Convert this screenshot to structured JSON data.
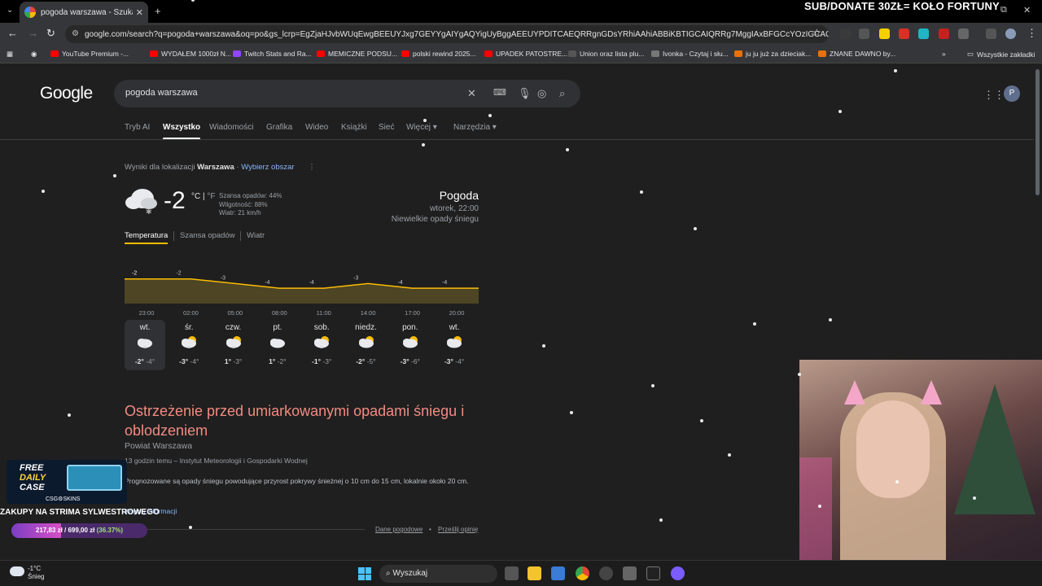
{
  "browser": {
    "tab_title": "pogoda warszawa - Szukaj w Go",
    "new_tab": "+",
    "url": "google.com/search?q=pogoda+warszawa&oq=po&gs_lcrp=EgZjaHJvbWUqEwgBEEUYJxg7GEYYgAIYgAQYigUyBggAEEUYPDITCAEQRRgnGDsYRhiAAhiABBiKBTIGCAIQRRg7MggIAxBFGCcYOzIGCAQQRRg8MgYIBRBF",
    "overlay_text": "SUB/DONATE 30ZŁ= KOŁO FORTUNY",
    "bookmarks": [
      "YouTube Premium -...",
      "WYDAŁEM 1000zł N...",
      "Twitch Stats and Ra...",
      "MEMICZNE PODSU...",
      "polski rewind 2025...",
      "UPADEK PATOSTRE...",
      "Union oraz lista plu...",
      "Ivonka - Czytaj i słu...",
      "ju ju już za dzieciak...",
      "ZNANE DAWNO by..."
    ],
    "all_bookmarks": "Wszystkie zakładki"
  },
  "google": {
    "logo": "Google",
    "query": "pogoda warszawa",
    "avatar": "P",
    "tabs": [
      "Tryb AI",
      "Wszystko",
      "Wiadomości",
      "Grafika",
      "Wideo",
      "Książki",
      "Sieć",
      "Więcej ▾",
      "Narzędzia ▾"
    ],
    "location_prefix": "Wyniki dla lokalizacji",
    "location": "Warszawa",
    "location_sep": " · ",
    "location_link": "Wybierz obszar"
  },
  "weather": {
    "temp": "-2",
    "unit_c": "°C",
    "unit_sep": " | ",
    "unit_f": "°F",
    "precip": "Szansa opadów: 44%",
    "humidity": "Wilgotność: 88%",
    "wind": "Wiatr: 21 km/h",
    "title": "Pogoda",
    "time": "wtorek, 22:00",
    "condition": "Niewielkie opady śniegu",
    "tabs": [
      "Temperatura",
      "Szansa opadów",
      "Wiatr"
    ],
    "days": [
      {
        "name": "wt.",
        "hi": "-2°",
        "lo": "-4°",
        "icon": "snow-cloud-icon"
      },
      {
        "name": "śr.",
        "hi": "-3°",
        "lo": "-4°",
        "icon": "partly-cloudy-snow-icon"
      },
      {
        "name": "czw.",
        "hi": "1°",
        "lo": "-3°",
        "icon": "partly-cloudy-snow-icon"
      },
      {
        "name": "pt.",
        "hi": "1°",
        "lo": "-2°",
        "icon": "cloud-icon"
      },
      {
        "name": "sob.",
        "hi": "-1°",
        "lo": "-3°",
        "icon": "partly-cloudy-snow-icon"
      },
      {
        "name": "niedz.",
        "hi": "-2°",
        "lo": "-5°",
        "icon": "partly-cloudy-icon"
      },
      {
        "name": "pon.",
        "hi": "-3°",
        "lo": "-6°",
        "icon": "partly-cloudy-icon"
      },
      {
        "name": "wt.",
        "hi": "-3°",
        "lo": "-4°",
        "icon": "partly-cloudy-icon"
      }
    ]
  },
  "chart_data": {
    "type": "area",
    "x": [
      "23:00",
      "02:00",
      "05:00",
      "08:00",
      "11:00",
      "14:00",
      "17:00",
      "20:00"
    ],
    "series": [
      {
        "values": [
          -2,
          -2,
          -3,
          -4,
          -4,
          -3,
          -4,
          -4
        ]
      }
    ],
    "point_labels": [
      "-2",
      "-2",
      "-3",
      "-4",
      "-4",
      "-3",
      "-4",
      "-4"
    ],
    "ylim": [
      -8,
      -1
    ],
    "colors": {
      "line": "#fbbc04",
      "fill": "#4d4524"
    }
  },
  "alert": {
    "title": "Ostrzeżenie przed umiarkowanymi opadami śniegu i oblodzeniem",
    "area": "Powiat Warszawa",
    "source": "13 godzin temu – Instytut Meteorologii i Gospodarki Wodnej",
    "body": "Prognozowane są opady śniegu powodujące przyrost pokrywy śnieżnej o 10 cm do 15 cm, lokalnie około 20 cm.",
    "more": "Więcej informacji"
  },
  "footer": {
    "data_link": "Dane pogodowe",
    "dot": "•",
    "feedback": "Prześlij opinię"
  },
  "stream": {
    "promo_line1": "FREE",
    "promo_line2": "DAILY",
    "promo_line3": "CASE",
    "promo_brand": "CSG⚙SKINS",
    "goal_title": "ZAKUPY NA STRIMA SYLWESTROWEGO",
    "goal_amount": "217,83 zł / 699,00 zł",
    "goal_percent": "(36.37%)",
    "goal_fraction": 0.3637
  },
  "taskbar": {
    "weather_temp": "-1°C",
    "weather_desc": "Śnieg",
    "search": "Wyszukaj"
  }
}
